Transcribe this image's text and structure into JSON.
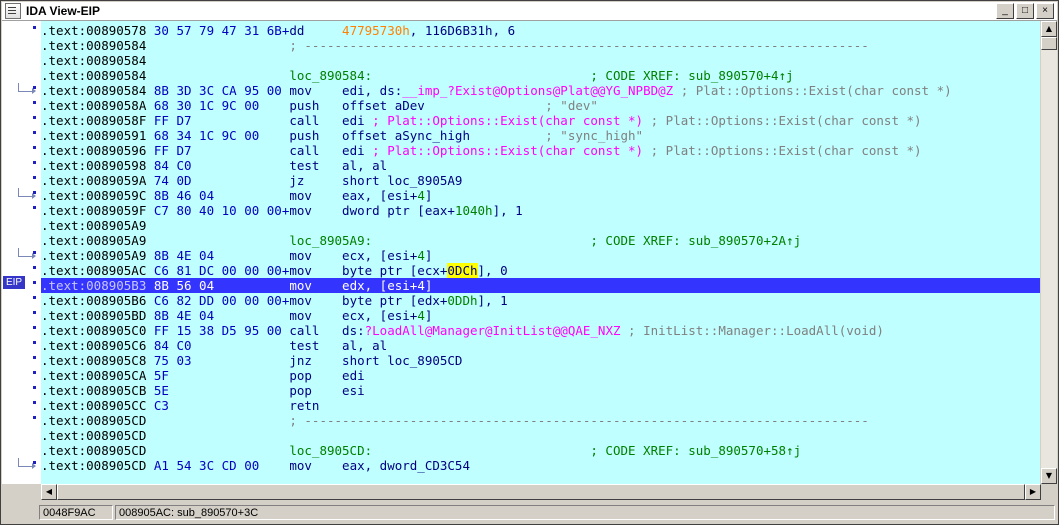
{
  "window": {
    "title": "IDA View-EIP",
    "btn_minimize": "_",
    "btn_maximize": "□",
    "btn_close": "×"
  },
  "gutter": {
    "eip_label": "EIP"
  },
  "lines": [
    [
      ".text:00890578 ",
      "30 57 79 47 31 6B+",
      "dd     ",
      "",
      "",
      "47795730h",
      ", 116D6B31h, 6"
    ],
    [
      ".text:00890584 ",
      "",
      "",
      "",
      "",
      "",
      "                  ; ---------------------------------------------------------------------------"
    ],
    [
      ".text:00890584",
      "",
      "",
      "",
      "",
      "",
      ""
    ],
    [
      ".text:00890584 ",
      "",
      "",
      "",
      "",
      "",
      "                  loc_890584:                             ; CODE XREF: sub_890570+4↑j"
    ],
    [
      ".text:00890584 ",
      "8B 3D 3C CA 95 00 ",
      "mov    ",
      "edi, ds:",
      "__imp_?Exist@Options@Plat@@YG_NPBD@Z",
      "",
      " ; Plat::Options::Exist(char const *)"
    ],
    [
      ".text:0089058A ",
      "68 30 1C 9C 00    ",
      "push   ",
      "offset aDev",
      "",
      "",
      "                ; \"dev\""
    ],
    [
      ".text:0089058F ",
      "FF D7             ",
      "call   ",
      "edi ",
      "; Plat::Options::Exist(char const *)",
      "",
      " ; Plat::Options::Exist(char const *)"
    ],
    [
      ".text:00890591 ",
      "68 34 1C 9C 00    ",
      "push   ",
      "offset aSync_high",
      "",
      "",
      "          ; \"sync_high\""
    ],
    [
      ".text:00890596 ",
      "FF D7             ",
      "call   ",
      "edi ",
      "; Plat::Options::Exist(char const *)",
      "",
      " ; Plat::Options::Exist(char const *)"
    ],
    [
      ".text:00890598 ",
      "84 C0             ",
      "test   ",
      "al, al",
      "",
      "",
      ""
    ],
    [
      ".text:0089059A ",
      "74 0D             ",
      "jz     ",
      "short loc_8905A9",
      "",
      "",
      ""
    ],
    [
      ".text:0089059C ",
      "8B 46 04          ",
      "mov    ",
      "eax, [esi+",
      "",
      "4",
      "]"
    ],
    [
      ".text:0089059F ",
      "C7 80 40 10 00 00+",
      "mov    ",
      "dword ptr [eax+",
      "",
      "1040h",
      "], 1"
    ],
    [
      ".text:008905A9",
      "",
      "",
      "",
      "",
      "",
      ""
    ],
    [
      ".text:008905A9 ",
      "",
      "",
      "",
      "",
      "",
      "                  loc_8905A9:                             ; CODE XREF: sub_890570+2A↑j"
    ],
    [
      ".text:008905A9 ",
      "8B 4E 04          ",
      "mov    ",
      "ecx, [esi+",
      "",
      "4",
      "]"
    ],
    [
      ".text:008905AC ",
      "C6 81 DC 00 00 00+",
      "mov    ",
      "byte ptr [ecx+",
      "",
      "0DCh",
      "], 0"
    ],
    [
      ".text:008905B3 ",
      "8B 56 04          ",
      "mov    ",
      "edx, [esi+",
      "",
      "4",
      "]"
    ],
    [
      ".text:008905B6 ",
      "C6 82 DD 00 00 00+",
      "mov    ",
      "byte ptr [edx+",
      "",
      "0DDh",
      "], 1"
    ],
    [
      ".text:008905BD ",
      "8B 4E 04          ",
      "mov    ",
      "ecx, [esi+",
      "",
      "4",
      "]"
    ],
    [
      ".text:008905C0 ",
      "FF 15 38 D5 95 00 ",
      "call   ",
      "ds:",
      "?LoadAll@Manager@InitList@@QAE_NXZ",
      "",
      " ; InitList::Manager::LoadAll(void)"
    ],
    [
      ".text:008905C6 ",
      "84 C0             ",
      "test   ",
      "al, al",
      "",
      "",
      ""
    ],
    [
      ".text:008905C8 ",
      "75 03             ",
      "jnz    ",
      "short loc_8905CD",
      "",
      "",
      ""
    ],
    [
      ".text:008905CA ",
      "5F                ",
      "pop    ",
      "edi",
      "",
      "",
      ""
    ],
    [
      ".text:008905CB ",
      "5E                ",
      "pop    ",
      "esi",
      "",
      "",
      ""
    ],
    [
      ".text:008905CC ",
      "C3                ",
      "retn",
      "",
      "",
      "",
      ""
    ],
    [
      ".text:008905CD ",
      "",
      "",
      "",
      "",
      "",
      "                  ; ---------------------------------------------------------------------------"
    ],
    [
      ".text:008905CD",
      "",
      "",
      "",
      "",
      "",
      ""
    ],
    [
      ".text:008905CD ",
      "",
      "",
      "",
      "",
      "",
      "                  loc_8905CD:                             ; CODE XREF: sub_890570+58↑j"
    ],
    [
      ".text:008905CD ",
      "A1 54 3C CD 00    ",
      "mov    ",
      "eax, dword_CD3C54",
      "",
      "",
      ""
    ]
  ],
  "status": {
    "left": "0048F9AC",
    "right": "008905AC: sub_890570+3C"
  }
}
